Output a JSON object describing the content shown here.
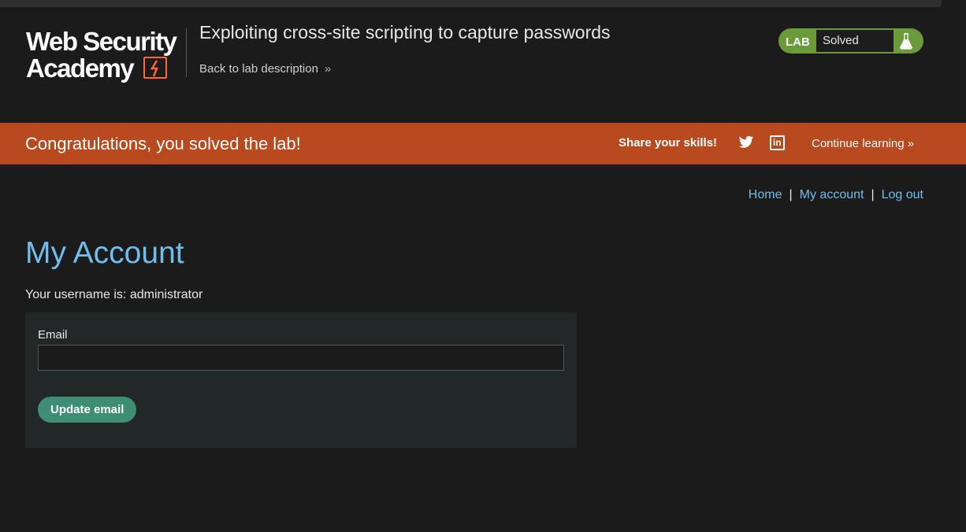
{
  "header": {
    "logo_line1": "Web Security",
    "logo_line2": "Academy",
    "lab_title": "Exploiting cross-site scripting to capture passwords",
    "back_link": "Back to lab description",
    "status_tag": "LAB",
    "status_value": "Solved"
  },
  "banner": {
    "message": "Congratulations, you solved the lab!",
    "share_label": "Share your skills!",
    "continue_label": "Continue learning"
  },
  "nav": {
    "home": "Home",
    "separator": "|",
    "my_account": "My account",
    "log_out": "Log out"
  },
  "account": {
    "title": "My Account",
    "username_prefix": "Your username is: ",
    "username": "administrator",
    "email_label": "Email",
    "email_value": "",
    "update_button": "Update email"
  },
  "colors": {
    "banner": "#b94a1f",
    "link": "#70bdec",
    "solved": "#6a9a3a",
    "button": "#3e8e74"
  }
}
